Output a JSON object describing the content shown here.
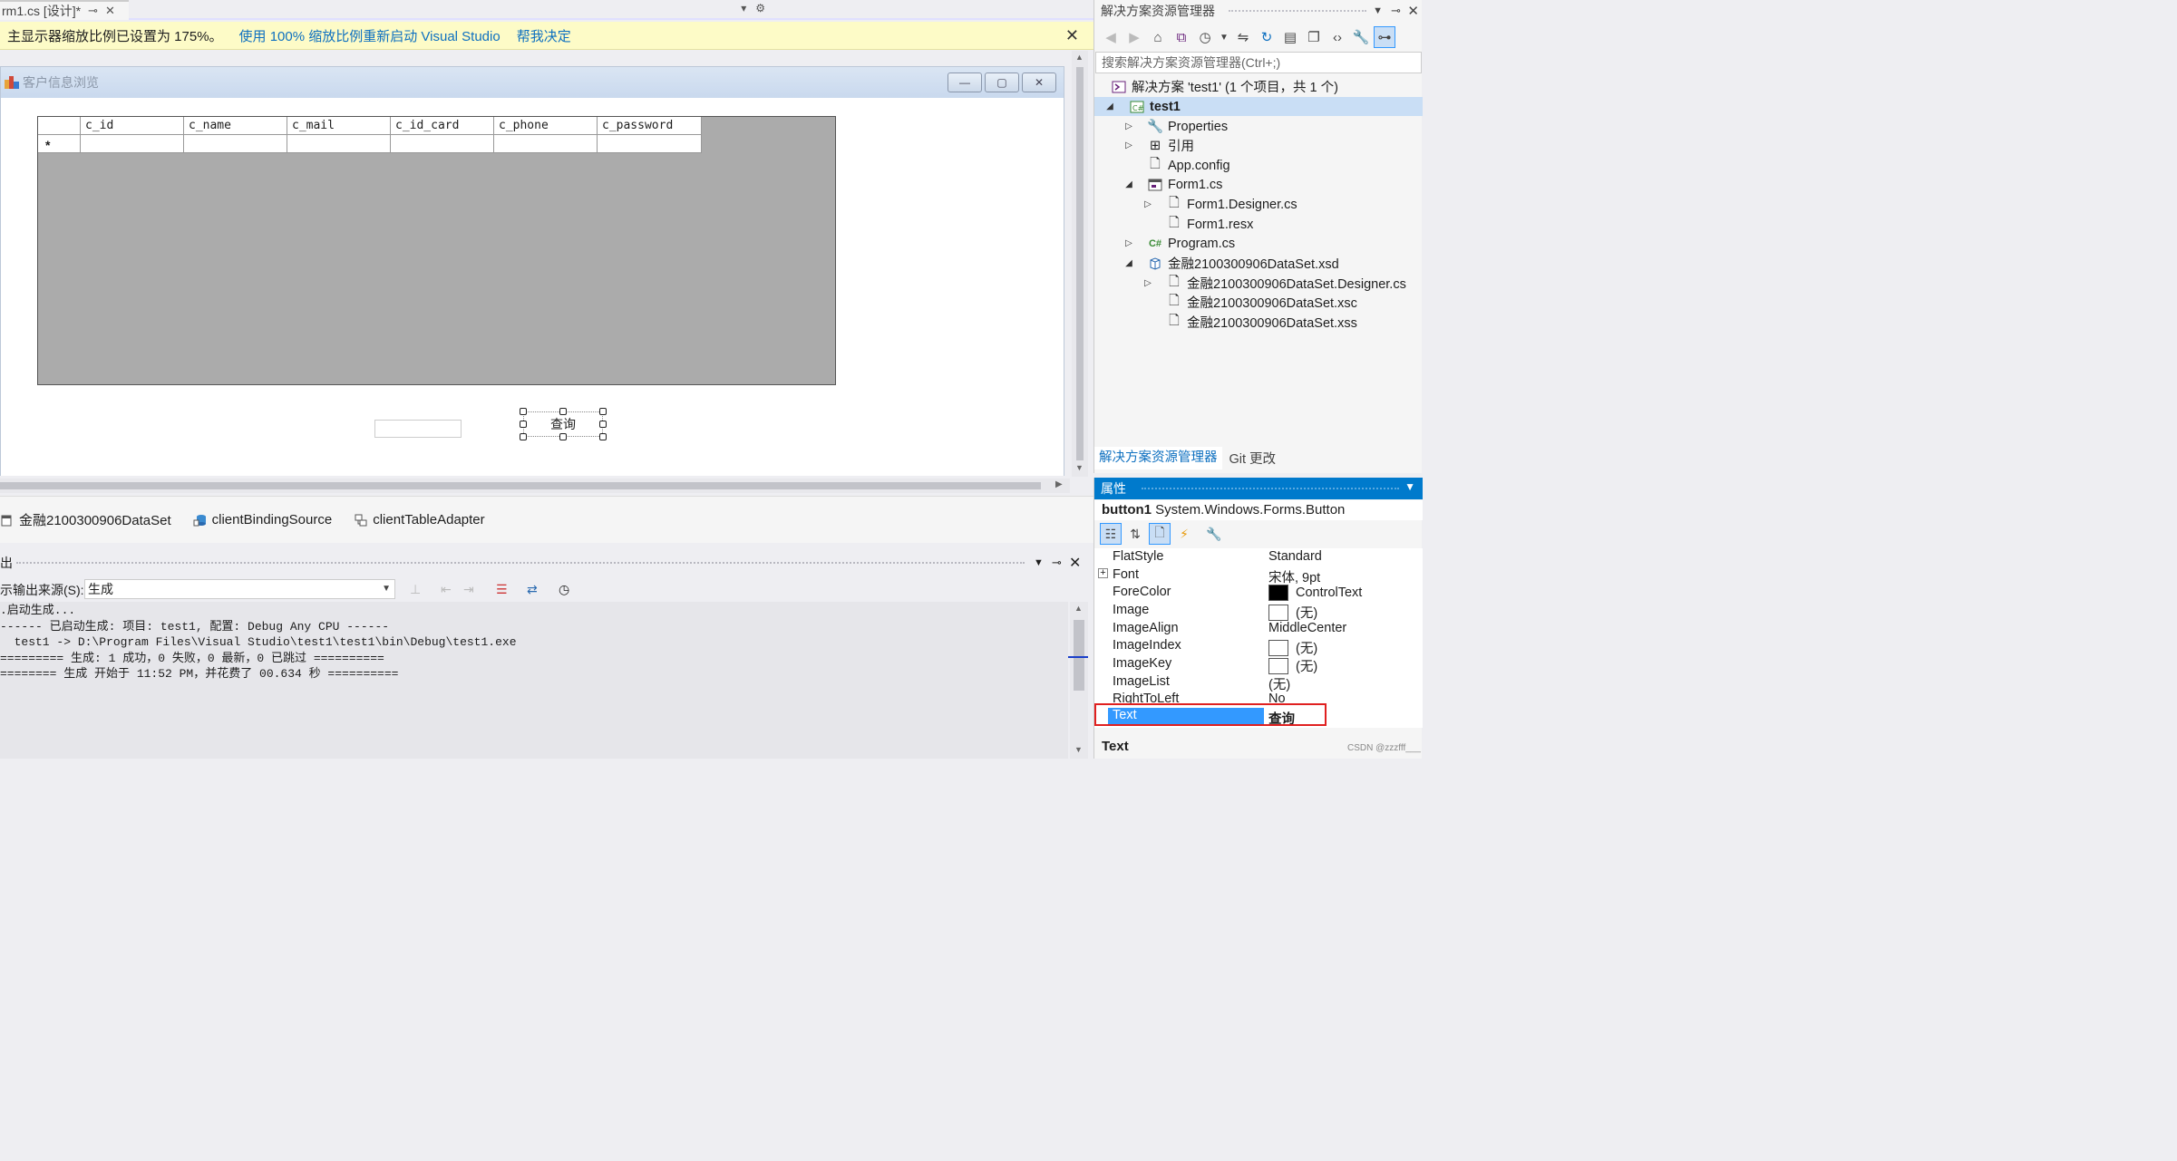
{
  "doc_tab": {
    "title": "rm1.cs [设计]*",
    "pin": "⊸",
    "close": "✕"
  },
  "infobar": {
    "message": "主显示器缩放比例已设置为 175%。",
    "link1": "使用 100% 缩放比例重新启动 Visual Studio",
    "link2": "帮我决定",
    "close": "✕"
  },
  "form": {
    "title": "客户信息浏览",
    "minimize": "—",
    "maximize": "▢",
    "close": "✕",
    "grid": {
      "columns": [
        "c_id",
        "c_name",
        "c_mail",
        "c_id_card",
        "c_phone",
        "c_password"
      ],
      "new_row_marker": "*"
    },
    "textbox_value": "",
    "button_label": "查询"
  },
  "tray": {
    "items": [
      "金融2100300906DataSet",
      "clientBindingSource",
      "clientTableAdapter"
    ]
  },
  "output": {
    "title": "出",
    "source_label": "示输出来源(S):",
    "source_value": "生成",
    "lines": [
      ".启动生成...",
      "------ 已启动生成: 项目: test1, 配置: Debug Any CPU ------",
      "  test1 -> D:\\Program Files\\Visual Studio\\test1\\test1\\bin\\Debug\\test1.exe",
      "========= 生成: 1 成功，0 失败，0 最新，0 已跳过 ==========",
      "======== 生成 开始于 11:52 PM，并花费了 00.634 秒 =========="
    ]
  },
  "solution_explorer": {
    "title": "解决方案资源管理器",
    "search_placeholder": "搜索解决方案资源管理器(Ctrl+;)",
    "tree": [
      {
        "label": "解决方案 'test1' (1 个项目，共 1 个)",
        "icon": "solution-icon",
        "level": 0,
        "expander": ""
      },
      {
        "label": "test1",
        "icon": "csharp-project-icon",
        "level": 0,
        "expander": "◢",
        "selected": true
      },
      {
        "label": "Properties",
        "icon": "wrench-icon",
        "level": 1,
        "expander": "▷"
      },
      {
        "label": "引用",
        "icon": "references-icon",
        "level": 1,
        "expander": "▷"
      },
      {
        "label": "App.config",
        "icon": "config-file-icon",
        "level": 1,
        "expander": ""
      },
      {
        "label": "Form1.cs",
        "icon": "form-icon",
        "level": 1,
        "expander": "◢"
      },
      {
        "label": "Form1.Designer.cs",
        "icon": "file-icon",
        "level": 2,
        "expander": "▷"
      },
      {
        "label": "Form1.resx",
        "icon": "file-icon",
        "level": 2,
        "expander": ""
      },
      {
        "label": "Program.cs",
        "icon": "csharp-file-icon",
        "level": 1,
        "expander": "▷"
      },
      {
        "label": "金融2100300906DataSet.xsd",
        "icon": "dataset-icon",
        "level": 1,
        "expander": "◢"
      },
      {
        "label": "金融2100300906DataSet.Designer.cs",
        "icon": "file-icon",
        "level": 2,
        "expander": "▷"
      },
      {
        "label": "金融2100300906DataSet.xsc",
        "icon": "file-icon",
        "level": 2,
        "expander": ""
      },
      {
        "label": "金融2100300906DataSet.xss",
        "icon": "file-icon",
        "level": 2,
        "expander": ""
      }
    ],
    "tab_active": "解决方案资源管理器",
    "tab_other": "Git 更改"
  },
  "properties": {
    "title": "属性",
    "object_name": "button1",
    "object_type": "System.Windows.Forms.Button",
    "rows": [
      {
        "name": "FlatStyle",
        "value": "Standard"
      },
      {
        "name": "Font",
        "value": "宋体, 9pt",
        "expandable": true
      },
      {
        "name": "ForeColor",
        "value": "ControlText",
        "swatch": "#000000"
      },
      {
        "name": "Image",
        "value": "(无)",
        "swatch": "#ffffff"
      },
      {
        "name": "ImageAlign",
        "value": "MiddleCenter"
      },
      {
        "name": "ImageIndex",
        "value": "(无)",
        "swatch": "#ffffff"
      },
      {
        "name": "ImageKey",
        "value": "(无)",
        "swatch": "#ffffff"
      },
      {
        "name": "ImageList",
        "value": "(无)"
      },
      {
        "name": "RightToLeft",
        "value": "No"
      },
      {
        "name": "Text",
        "value": "查询",
        "selected": true
      }
    ],
    "description_title": "Text"
  },
  "watermark": "CSDN @zzzfff___",
  "colors": {
    "accent": "#007acc",
    "selection": "#3399ff",
    "highlight_box": "#e02020",
    "infobar": "#fdfbc7"
  }
}
